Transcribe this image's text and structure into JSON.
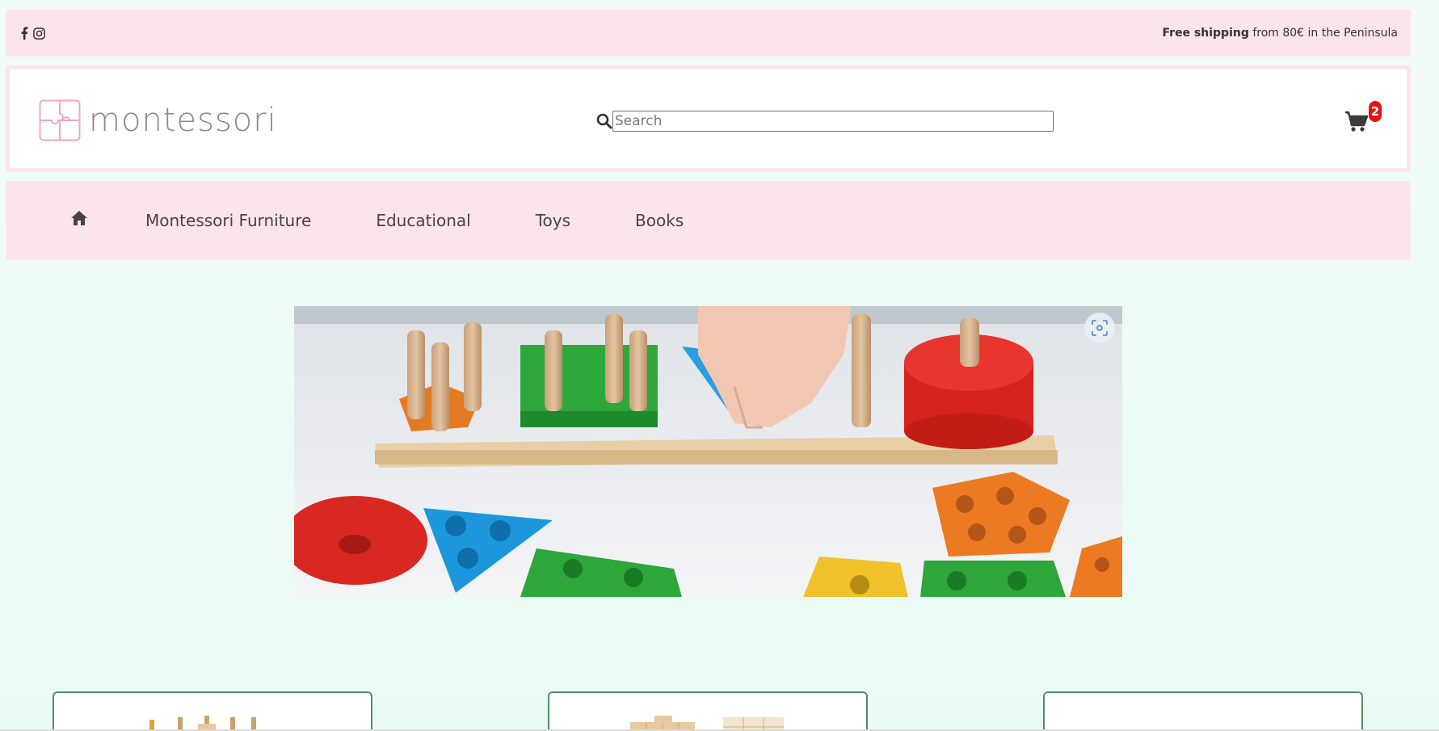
{
  "topbar": {
    "social_icons": [
      "facebook-icon",
      "instagram-icon"
    ],
    "shipping_bold": "Free shipping",
    "shipping_rest": " from 80€ in the Peninsula"
  },
  "header": {
    "logo_text": "montessori",
    "search": {
      "placeholder": "Search",
      "value": ""
    },
    "cart": {
      "icon": "cart-icon",
      "count": "2"
    }
  },
  "nav": {
    "home_icon": "home-icon",
    "items": [
      {
        "label": "Montessori Furniture"
      },
      {
        "label": "Educational"
      },
      {
        "label": "Toys"
      },
      {
        "label": "Books"
      }
    ]
  },
  "hero": {
    "image": "Wooden shape sorter with pegs and colored shapes",
    "lens_icon": "visual-search-icon"
  },
  "products": [
    {
      "thumb": "peg-stacking-toy"
    },
    {
      "thumb": "wooden-number-blocks"
    },
    {
      "thumb": ""
    }
  ],
  "colors": {
    "accent_pink": "#fce4ed",
    "badge_red": "#e31313",
    "card_border": "#4f8f66"
  }
}
